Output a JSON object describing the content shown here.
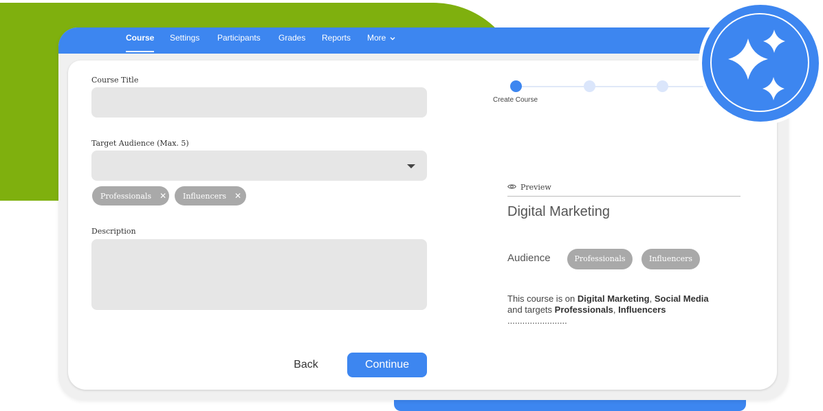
{
  "nav": {
    "items": [
      "Course",
      "Settings",
      "Participants",
      "Grades",
      "Reports",
      "More"
    ],
    "active": "Course"
  },
  "form": {
    "course_title_label": "Course Title",
    "course_title_value": "",
    "audience_label": "Target Audience (Max. 5)",
    "audience_chips": [
      "Professionals",
      "Influencers"
    ],
    "description_label": "Description",
    "description_value": "",
    "back_label": "Back",
    "continue_label": "Continue"
  },
  "stepper": {
    "current_step_label": "Create Course",
    "total_steps": 4,
    "current_step": 1
  },
  "preview": {
    "label": "Preview",
    "title": "Digital Marketing",
    "audience_label": "Audience",
    "audience_chips": [
      "Professionals",
      "Influencers"
    ],
    "desc_prefix": "This course is on ",
    "desc_topic1": "Digital Marketing",
    "desc_sep1": ", ",
    "desc_topic2": "Social Media",
    "desc_mid": " and targets ",
    "desc_aud1": "Professionals",
    "desc_sep2": ", ",
    "desc_aud2": "Influencers",
    "desc_dots": "........................"
  },
  "colors": {
    "accent": "#3d86f0",
    "green": "#7fb00e",
    "chip": "#a9a9a9",
    "field": "#e6e6e6"
  },
  "icons": {
    "badge": "sparkle-icon",
    "preview": "eye-icon",
    "chip_remove": "close-icon",
    "dropdown": "chevron-down-icon"
  }
}
